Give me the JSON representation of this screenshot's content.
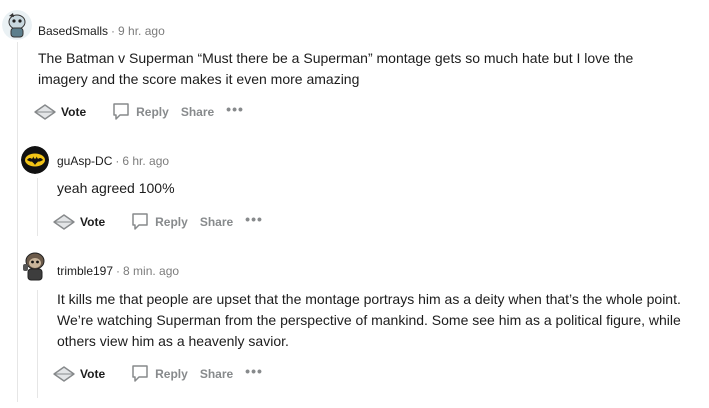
{
  "comments": [
    {
      "username": "BasedSmalls",
      "separator": "·",
      "time": "9 hr. ago",
      "text": "The Batman v Superman “Must there be a Superman” montage gets so much hate but I love the imagery and the score makes it even more amazing",
      "avatar_icon": "snoo-avatar-icon"
    },
    {
      "username": "guAsp-DC",
      "separator": "·",
      "time": "6 hr. ago",
      "text": "yeah agreed 100%",
      "avatar_icon": "bat-logo-icon"
    },
    {
      "username": "trimble197",
      "separator": "·",
      "time": "8 min. ago",
      "text": "It kills me that people are upset that the montage portrays him as a deity when that’s the whole point. We’re watching Superman from the perspective of mankind. Some see him as a political figure, while others view him as a heavenly savior.",
      "avatar_icon": "snoo-avatar-icon"
    }
  ],
  "actions": {
    "vote": "Vote",
    "reply": "Reply",
    "share": "Share",
    "more": "•••"
  },
  "colors": {
    "thread_line": "#e6e6e6",
    "meta_gray": "#7c7c7c",
    "action_gray": "#878a8c"
  }
}
